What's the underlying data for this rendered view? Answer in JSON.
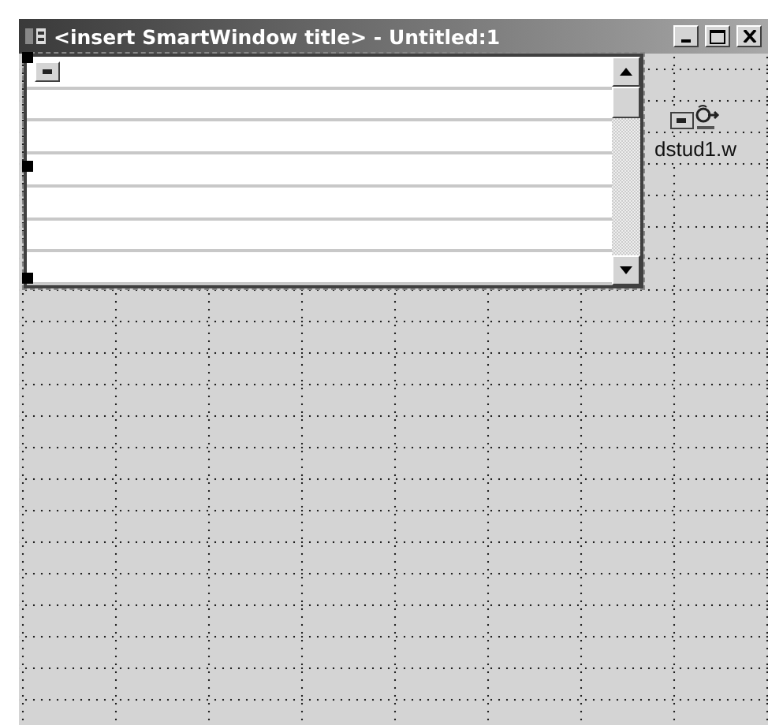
{
  "window": {
    "title": "<insert SmartWindow title> - Untitled:1"
  },
  "browse": {
    "selected": true
  },
  "objects": [
    {
      "kind": "sdo",
      "label": "dstud1.w"
    }
  ]
}
